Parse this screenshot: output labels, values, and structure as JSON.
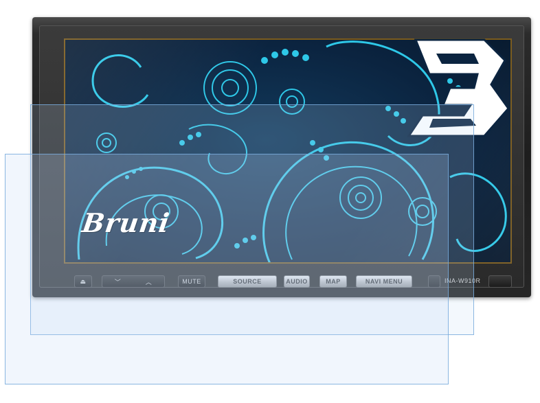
{
  "product": {
    "brand_watermark": "Bruni",
    "model_label": "INA-W910R"
  },
  "device_buttons": {
    "eject": "⏏",
    "volume_down": "﹀",
    "volume_up": "︿",
    "mute": "MUTE",
    "source": "SOURCE",
    "audio": "AUDIO",
    "map": "MAP",
    "navi_menu": "NAVI MENU"
  },
  "colors": {
    "pattern": "#2ec8e8",
    "screen_bg": "#0b2440",
    "protector_border": "#78aadc"
  }
}
